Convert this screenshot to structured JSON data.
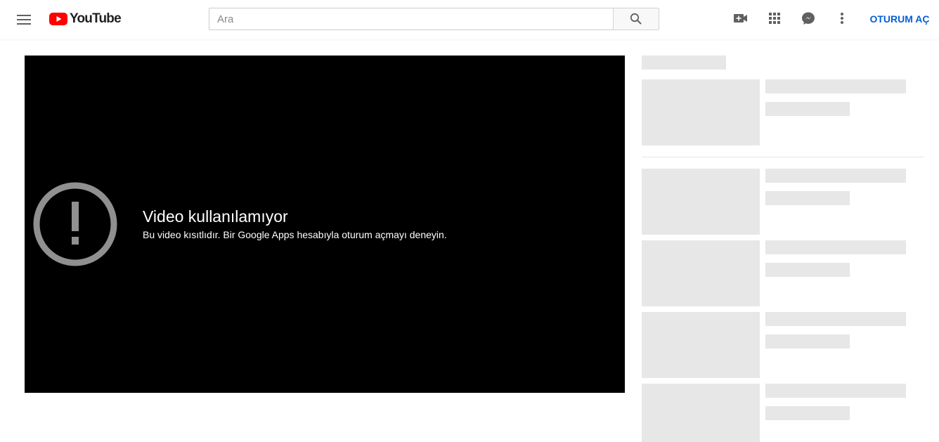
{
  "header": {
    "logo_text": "YouTube",
    "search": {
      "placeholder": "Ara",
      "value": ""
    },
    "sign_in_label": "OTURUM AÇ",
    "icons": [
      "menu-icon",
      "youtube-play-icon",
      "search-icon",
      "create-video-icon",
      "apps-grid-icon",
      "messages-icon",
      "more-vert-icon"
    ]
  },
  "player": {
    "error_title": "Video kullanılamıyor",
    "error_message": "Bu video kısıtlıdır. Bir Google Apps hesabıyla oturum açmayı deneyin."
  },
  "colors": {
    "brand_red": "#ff0000",
    "link_blue": "#065fd4",
    "skeleton": "#e7e7e7",
    "player_bg": "#000000",
    "error_icon": "#909090"
  }
}
